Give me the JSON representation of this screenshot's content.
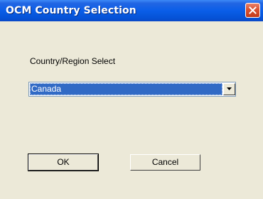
{
  "window": {
    "title": "OCM Country Selection"
  },
  "form": {
    "country_label": "Country/Region Select",
    "country_select": {
      "selected": "Canada"
    }
  },
  "buttons": {
    "ok_label": "OK",
    "cancel_label": "Cancel"
  },
  "icons": {
    "close": "close-icon",
    "dropdown": "chevron-down-icon"
  },
  "colors": {
    "titlebar": "#0a5ee8",
    "close_button": "#d9512f",
    "selection": "#316ac5",
    "dialog_background": "#ece9d8"
  }
}
